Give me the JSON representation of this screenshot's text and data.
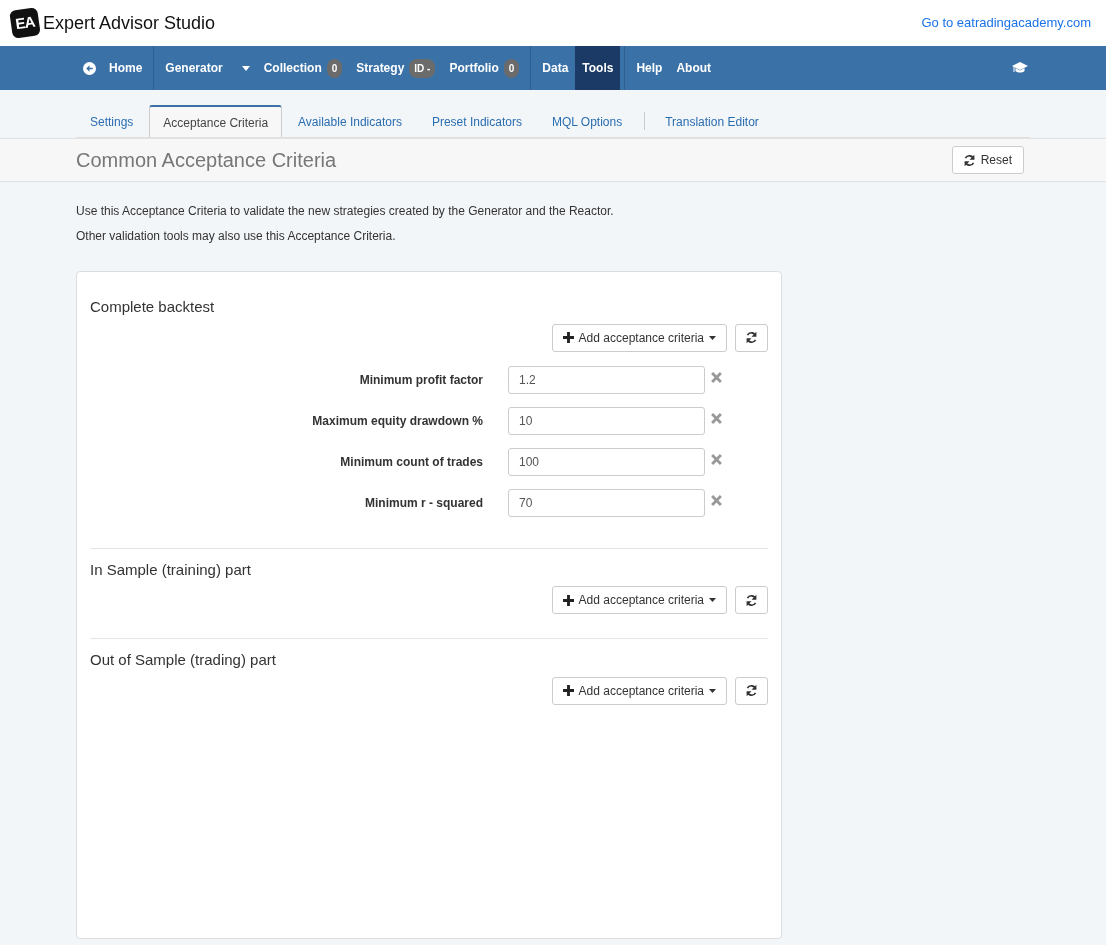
{
  "app": {
    "logo": "EA",
    "title": "Expert Advisor Studio",
    "link": "Go to eatradingacademy.com"
  },
  "nav": {
    "items": [
      {
        "kind": "home",
        "label": "Home",
        "selected": false
      },
      {
        "kind": "separator"
      },
      {
        "kind": "dropdown",
        "label": "Generator",
        "selected": false
      },
      {
        "kind": "link",
        "label": "Collection",
        "badge": "0",
        "selected": false
      },
      {
        "kind": "link",
        "label": "Strategy",
        "badge": "ID -",
        "selected": false
      },
      {
        "kind": "link",
        "label": "Portfolio",
        "badge": "0",
        "selected": false
      },
      {
        "kind": "separator"
      },
      {
        "kind": "link",
        "label": "Data",
        "selected": false
      },
      {
        "kind": "link",
        "label": "Tools",
        "selected": true
      },
      {
        "kind": "separator"
      },
      {
        "kind": "link",
        "label": "Help",
        "selected": false
      },
      {
        "kind": "link",
        "label": "About",
        "selected": false
      }
    ]
  },
  "tabs": [
    {
      "kind": "tab",
      "label": "Settings",
      "selected": false
    },
    {
      "kind": "tab",
      "label": "Acceptance Criteria",
      "selected": true
    },
    {
      "kind": "tab",
      "label": "Available Indicators",
      "selected": false
    },
    {
      "kind": "tab",
      "label": "Preset Indicators",
      "selected": false
    },
    {
      "kind": "tab",
      "label": "MQL Options",
      "selected": false
    },
    {
      "kind": "separator"
    },
    {
      "kind": "tab",
      "label": "Translation Editor",
      "selected": false
    }
  ],
  "page": {
    "title": "Common Acceptance Criteria",
    "reset_button": "Reset",
    "intro": [
      "Use this Acceptance Criteria to validate the new strategies created by the Generator and the Reactor.",
      "Other validation tools may also use this Acceptance Criteria."
    ]
  },
  "sections": [
    {
      "title": "Complete backtest",
      "add_button": "Add acceptance criteria",
      "criteria": [
        {
          "label": "Minimum profit factor",
          "value": "1.2"
        },
        {
          "label": "Maximum equity drawdown %",
          "value": "10"
        },
        {
          "label": "Minimum count of trades",
          "value": "100"
        },
        {
          "label": "Minimum r - squared",
          "value": "70"
        }
      ]
    },
    {
      "title": "In Sample (training) part",
      "add_button": "Add acceptance criteria"
    },
    {
      "title": "Out of Sample (trading) part",
      "add_button": "Add acceptance criteria"
    }
  ]
}
